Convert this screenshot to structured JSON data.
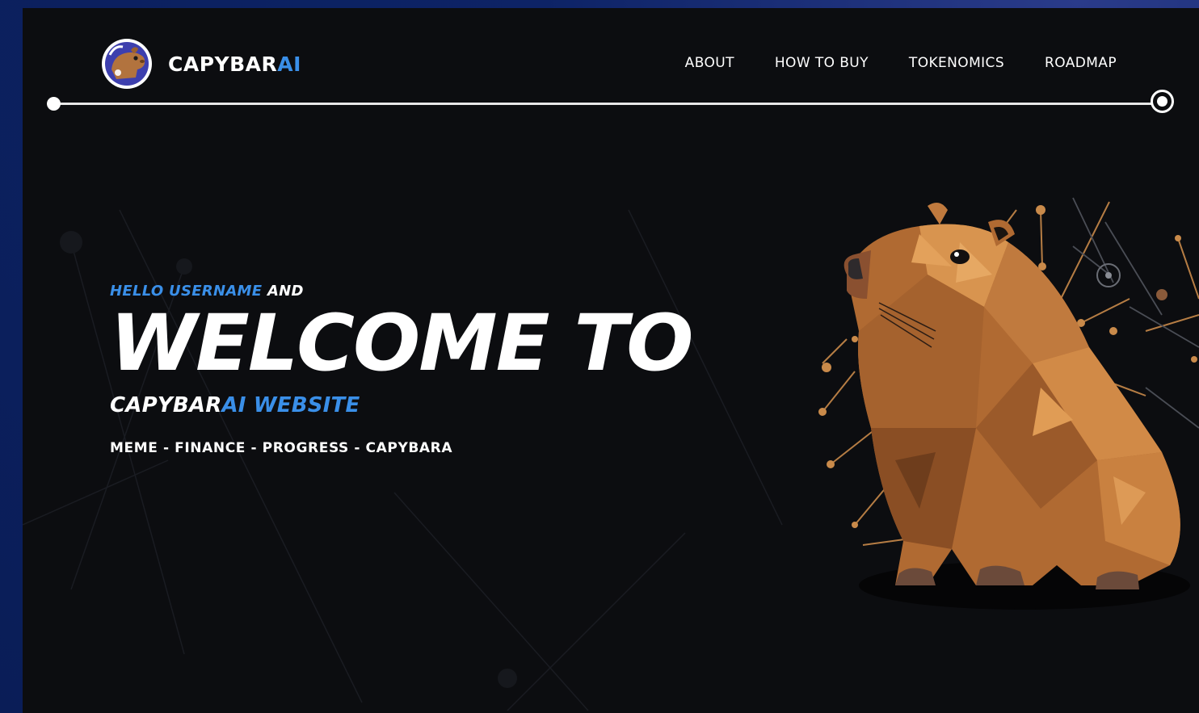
{
  "brand": {
    "name_main": "CAPYBAR",
    "name_accent": "AI",
    "accent_color": "#3a8fe8"
  },
  "nav": {
    "items": [
      {
        "label": "ABOUT"
      },
      {
        "label": "HOW TO BUY"
      },
      {
        "label": "TOKENOMICS"
      },
      {
        "label": "ROADMAP"
      }
    ]
  },
  "hero": {
    "greeting_accent": "HELLO USERNAME",
    "greeting_rest": " AND",
    "headline": "WELCOME TO",
    "sub_main": "CAPYBAR",
    "sub_accent": "AI WEBSITE",
    "tagline": "MEME - FINANCE - PROGRESS - CAPYBARA"
  },
  "icons": {
    "logo": "capybara-logo-icon",
    "hero_art": "capybara-illustration"
  },
  "colors": {
    "background": "#0c0d10",
    "outer": "#0a1d57",
    "text": "#ffffff",
    "capybara": "#c07a3e"
  }
}
